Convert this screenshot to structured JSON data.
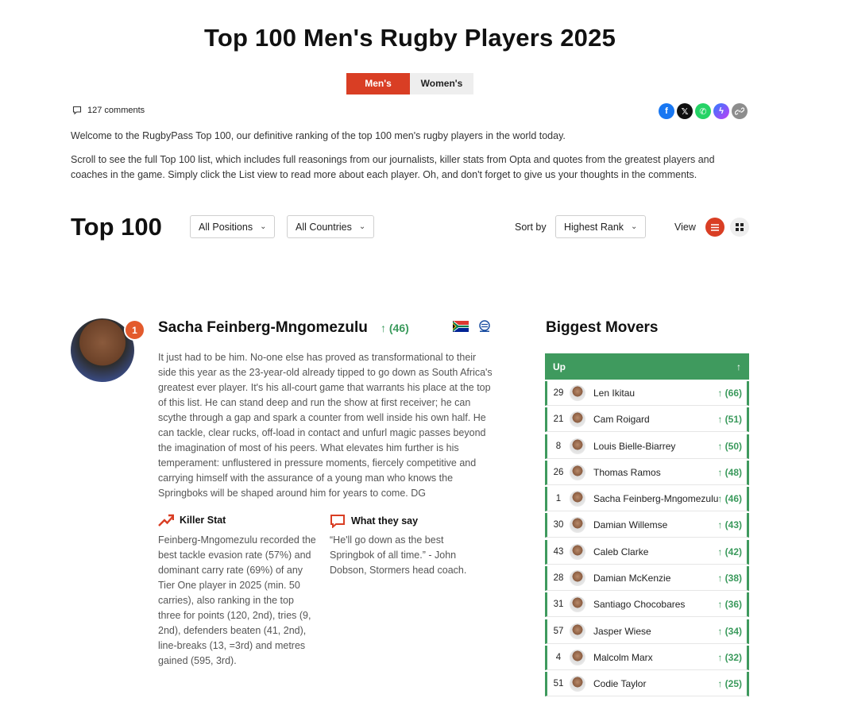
{
  "page": {
    "title": "Top 100 Men's Rugby Players 2025"
  },
  "tabs": [
    {
      "label": "Men's",
      "active": true
    },
    {
      "label": "Women's",
      "active": false
    }
  ],
  "comments": {
    "label": "127 comments",
    "icon": "comment-icon"
  },
  "share": [
    {
      "name": "facebook-icon",
      "glyph": "f",
      "color": "#1877f2"
    },
    {
      "name": "x-icon",
      "glyph": "𝕏",
      "color": "#111111"
    },
    {
      "name": "whatsapp-icon",
      "glyph": "✆",
      "color": "#25d366"
    },
    {
      "name": "messenger-icon",
      "glyph": "ϟ",
      "color": "#8a3ffc"
    },
    {
      "name": "link-icon",
      "glyph": "🔗",
      "color": "#888888"
    }
  ],
  "intro": {
    "p1": "Welcome to the RugbyPass Top 100, our definitive ranking of the top 100 men's rugby players in the world today.",
    "p2": "Scroll to see the full Top 100 list, which includes full reasonings from our journalists, killer stats from Opta and quotes from the greatest players and coaches in the game. Simply click the List view to read more about each player. Oh, and don't forget to give us your thoughts in the comments."
  },
  "controls": {
    "heading": "Top 100",
    "positions": "All Positions",
    "countries": "All Countries",
    "sort_label": "Sort by",
    "sort_value": "Highest Rank",
    "view_label": "View"
  },
  "player": {
    "rank": "1",
    "name": "Sacha Feinberg-Mngomezulu",
    "move": "(46)",
    "bio": "It just had to be him. No-one else has proved as transformational to their side this year as the 23-year-old already tipped to go down as South Africa's greatest ever player. It's his all-court game that warrants his place at the top of this list. He can stand deep and run the show at first receiver; he can scythe through a gap and spark a counter from well inside his own half. He can tackle, clear rucks, off-load in contact and unfurl magic passes beyond the imagination of most of his peers. What elevates him further is his temperament: unflustered in pressure moments, fiercely competitive and carrying himself with the assurance of a young man who knows the Springboks will be shaped around him for years to come. DG",
    "killer_stat_title": "Killer Stat",
    "killer_stat": "Feinberg-Mngomezulu recorded the best tackle evasion rate (57%) and dominant carry rate (69%) of any Tier One player in 2025 (min. 50 carries), also ranking in the top three for points (120, 2nd), tries (9, 2nd), defenders beaten (41, 2nd), line-breaks (13, =3rd) and metres gained (595, 3rd).",
    "quote_title": "What they say",
    "quote": "“He'll go down as the best Springbok of all time.” - John Dobson, Stormers head coach."
  },
  "movers": {
    "title": "Biggest Movers",
    "header": "Up",
    "rows": [
      {
        "rank": "29",
        "name": "Len Ikitau",
        "change": "(66)"
      },
      {
        "rank": "21",
        "name": "Cam Roigard",
        "change": "(51)"
      },
      {
        "rank": "8",
        "name": "Louis Bielle-Biarrey",
        "change": "(50)"
      },
      {
        "rank": "26",
        "name": "Thomas Ramos",
        "change": "(48)"
      },
      {
        "rank": "1",
        "name": "Sacha Feinberg-Mngomezulu",
        "change": "(46)"
      },
      {
        "rank": "30",
        "name": "Damian Willemse",
        "change": "(43)"
      },
      {
        "rank": "43",
        "name": "Caleb Clarke",
        "change": "(42)"
      },
      {
        "rank": "28",
        "name": "Damian McKenzie",
        "change": "(38)"
      },
      {
        "rank": "31",
        "name": "Santiago Chocobares",
        "change": "(36)"
      },
      {
        "rank": "57",
        "name": "Jasper Wiese",
        "change": "(34)"
      },
      {
        "rank": "4",
        "name": "Malcolm Marx",
        "change": "(32)"
      },
      {
        "rank": "51",
        "name": "Codie Taylor",
        "change": "(25)"
      }
    ]
  },
  "colors": {
    "accent": "#d93e24",
    "positive": "#3a9a5c",
    "movers_header": "#3f9a5e"
  }
}
